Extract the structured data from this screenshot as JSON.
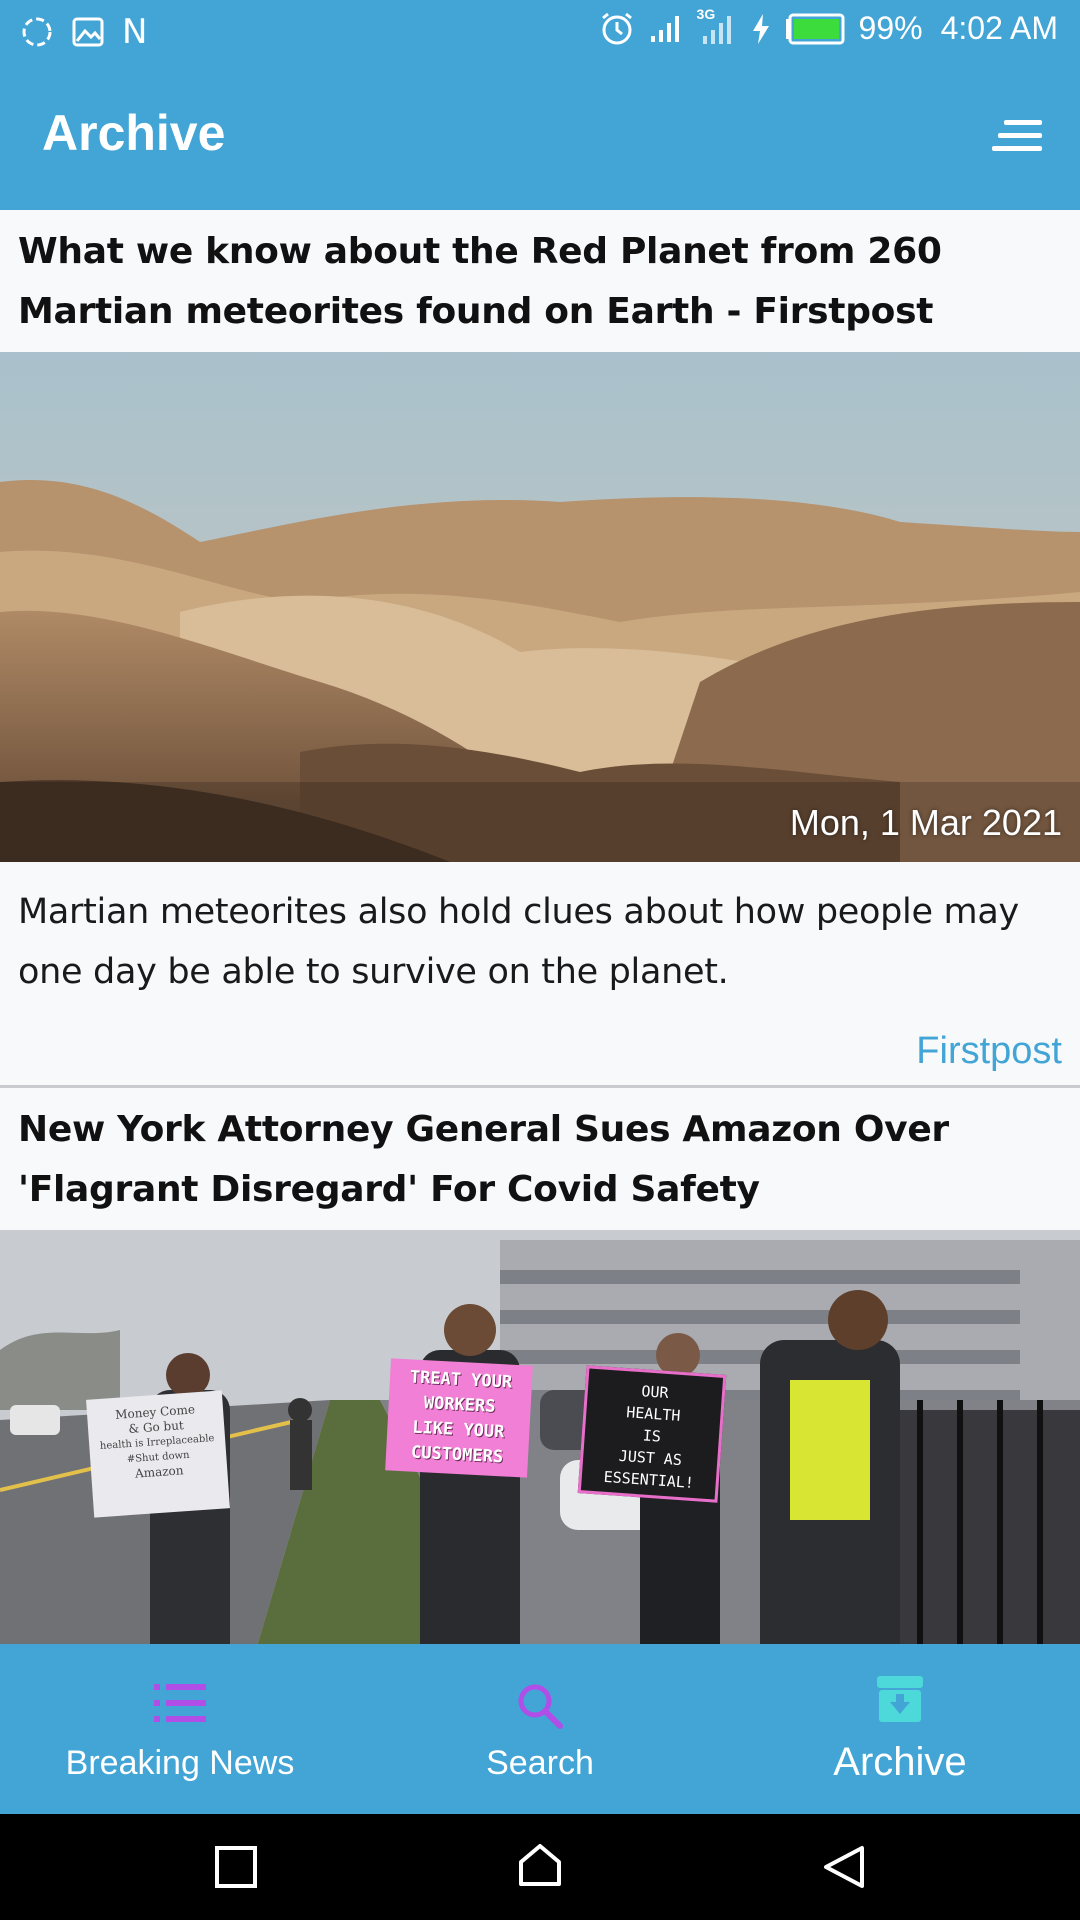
{
  "status_bar": {
    "battery": "99%",
    "time": "4:02 AM",
    "carrier_letter": "N",
    "network_label": "3G"
  },
  "app_bar": {
    "title": "Archive"
  },
  "articles": [
    {
      "title": "What we know about the Red Planet from 260 Martian meteorites found on Earth - Firstpost",
      "date": "Mon, 1 Mar 2021",
      "description": "Martian meteorites also hold clues about how people may one day be able to survive on the planet.",
      "source": "Firstpost"
    },
    {
      "title": "New York Attorney General Sues Amazon Over 'Flagrant Disregard' For Covid Safety",
      "signs": {
        "sign1": [
          "Money Come",
          "& Go but",
          "health is Irreplaceable",
          "#Shut down",
          "Amazon"
        ],
        "sign2": [
          "TREAT YOUR",
          "WORKERS",
          "LIKE YOUR",
          "CUSTOMERS"
        ],
        "sign3": [
          "OUR",
          "HEALTH",
          "IS",
          "JUST AS",
          "ESSENTIAL!"
        ]
      }
    }
  ],
  "bottom_nav": {
    "items": [
      {
        "label": "Breaking News",
        "icon": "list-icon"
      },
      {
        "label": "Search",
        "icon": "search-icon"
      },
      {
        "label": "Archive",
        "icon": "archive-icon"
      }
    ]
  },
  "colors": {
    "primary": "#42a5d6",
    "accent_icon": "#b14ee8",
    "archive_icon": "#4dd9d9"
  }
}
